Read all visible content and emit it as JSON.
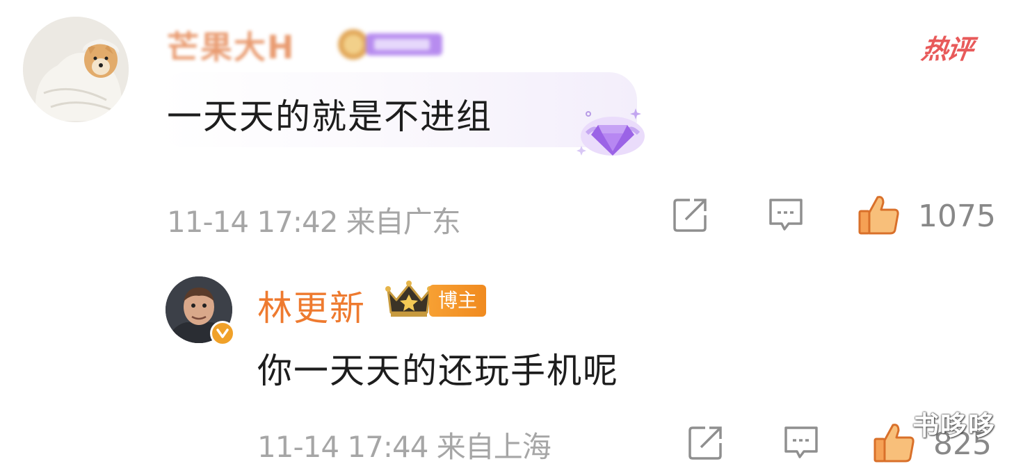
{
  "comment": {
    "username": "芒果大H",
    "tag": "热评",
    "text": "一天天的就是不进组",
    "timestamp": "11-14 17:42",
    "location": "来自广东",
    "likes": "1075",
    "accent_color": "#e58a58"
  },
  "reply": {
    "username": "林更新",
    "badge": "博主",
    "text": "你一天天的还玩手机呢",
    "timestamp": "11-14 17:44",
    "location": "来自上海",
    "likes": "825",
    "accent_color": "#ee7a2f"
  },
  "icons": {
    "share": "share-icon",
    "comment": "comment-icon",
    "like": "thumbs-up-icon",
    "crown": "crown-icon",
    "gem": "diamond-icon"
  },
  "watermark": "书哆哆"
}
